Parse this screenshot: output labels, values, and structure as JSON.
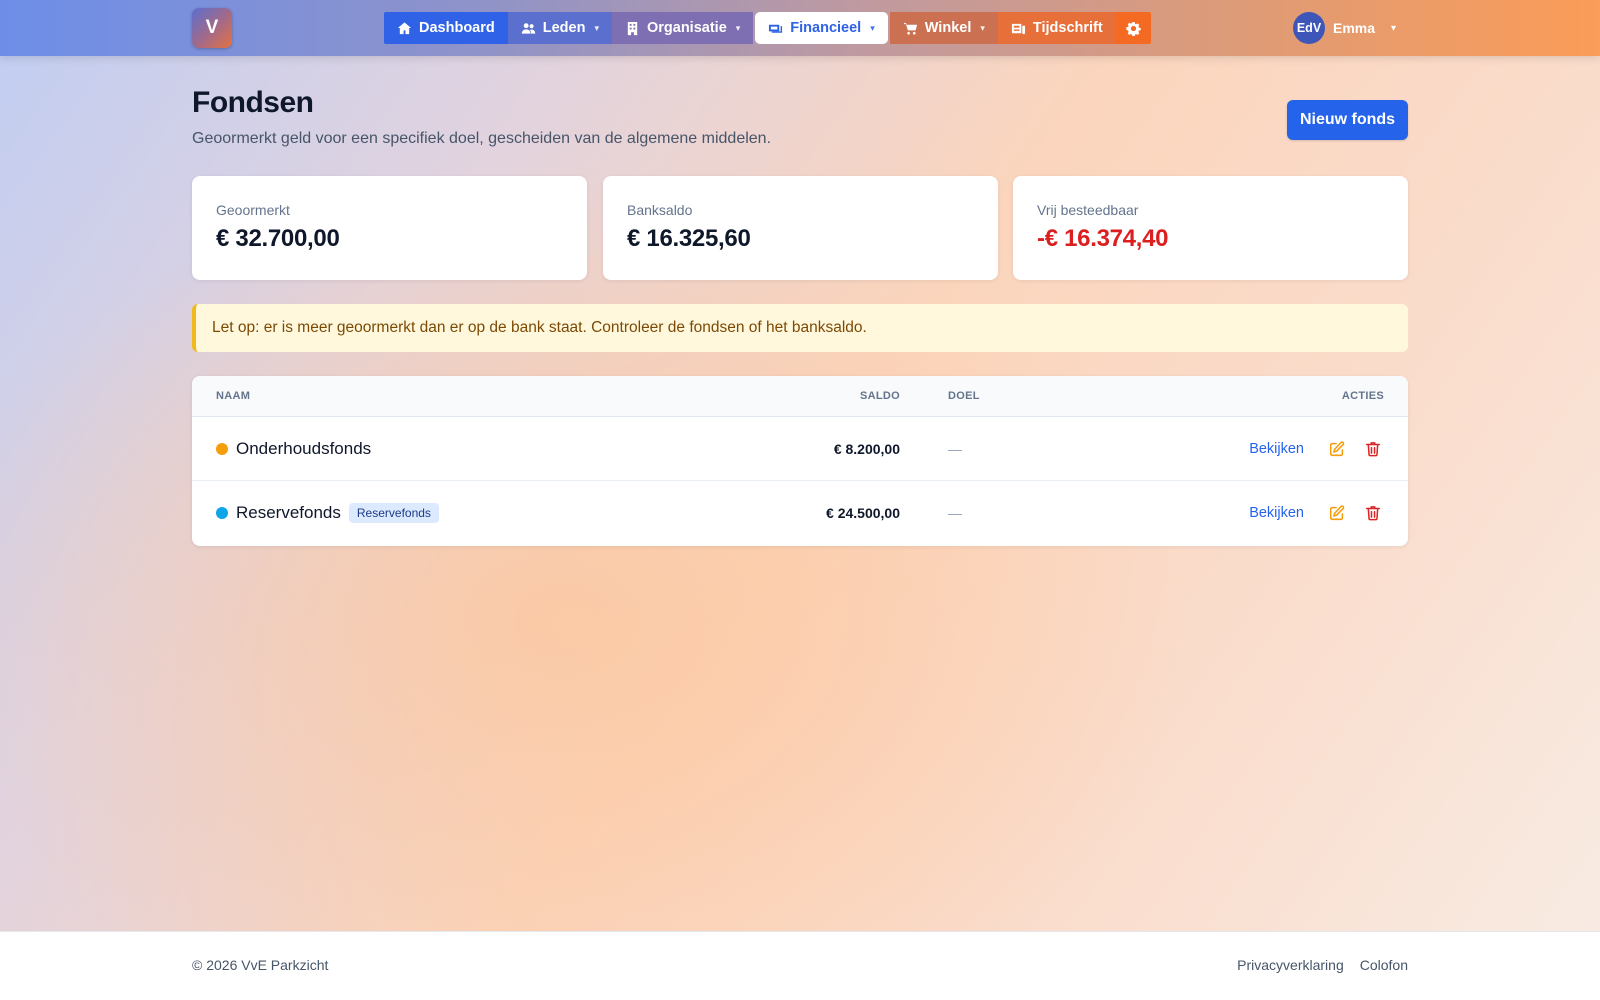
{
  "app": {
    "logo_letter": "V"
  },
  "nav": {
    "items": [
      {
        "label": "Dashboard",
        "icon": "home-icon"
      },
      {
        "label": "Leden",
        "icon": "users-icon"
      },
      {
        "label": "Organisatie",
        "icon": "building-icon"
      },
      {
        "label": "Financieel",
        "icon": "money-icon",
        "active": true
      },
      {
        "label": "Winkel",
        "icon": "cart-icon"
      },
      {
        "label": "Tijdschrift",
        "icon": "magazine-icon"
      }
    ],
    "settings_icon": "gear-icon"
  },
  "user": {
    "initials": "EdV",
    "name": "Emma"
  },
  "page": {
    "title": "Fondsen",
    "subtitle": "Geoormerkt geld voor een specifiek doel, gescheiden van de algemene middelen.",
    "new_button": "Nieuw fonds"
  },
  "stats": [
    {
      "label": "Geoormerkt",
      "value": "€ 32.700,00"
    },
    {
      "label": "Banksaldo",
      "value": "€ 16.325,60"
    },
    {
      "label": "Vrij besteedbaar",
      "value": "-€ 16.374,40",
      "color": "#dc1e1e"
    }
  ],
  "alert": {
    "text": "Let op: er is meer geoormerkt dan er op de bank staat. Controleer de fondsen of het banksaldo."
  },
  "table": {
    "headers": {
      "naam": "NAAM",
      "saldo": "SALDO",
      "doel": "DOEL",
      "acties": "ACTIES"
    },
    "rows": [
      {
        "name": "Onderhoudsfonds",
        "dot_color": "#f59e0b",
        "tag": "",
        "saldo": "€ 8.200,00",
        "doel": "—",
        "view": "Bekijken"
      },
      {
        "name": "Reservefonds",
        "dot_color": "#0ea5e9",
        "tag": "Reservefonds",
        "saldo": "€ 24.500,00",
        "doel": "—",
        "view": "Bekijken"
      }
    ]
  },
  "footer": {
    "copyright": "© 2026 VvE Parkzicht",
    "links": [
      "Privacyverklaring",
      "Colofon"
    ]
  },
  "colors": {
    "primary": "#2563eb",
    "danger": "#dc1e1e",
    "edit": "#f59e0b",
    "delete": "#dc2626"
  }
}
